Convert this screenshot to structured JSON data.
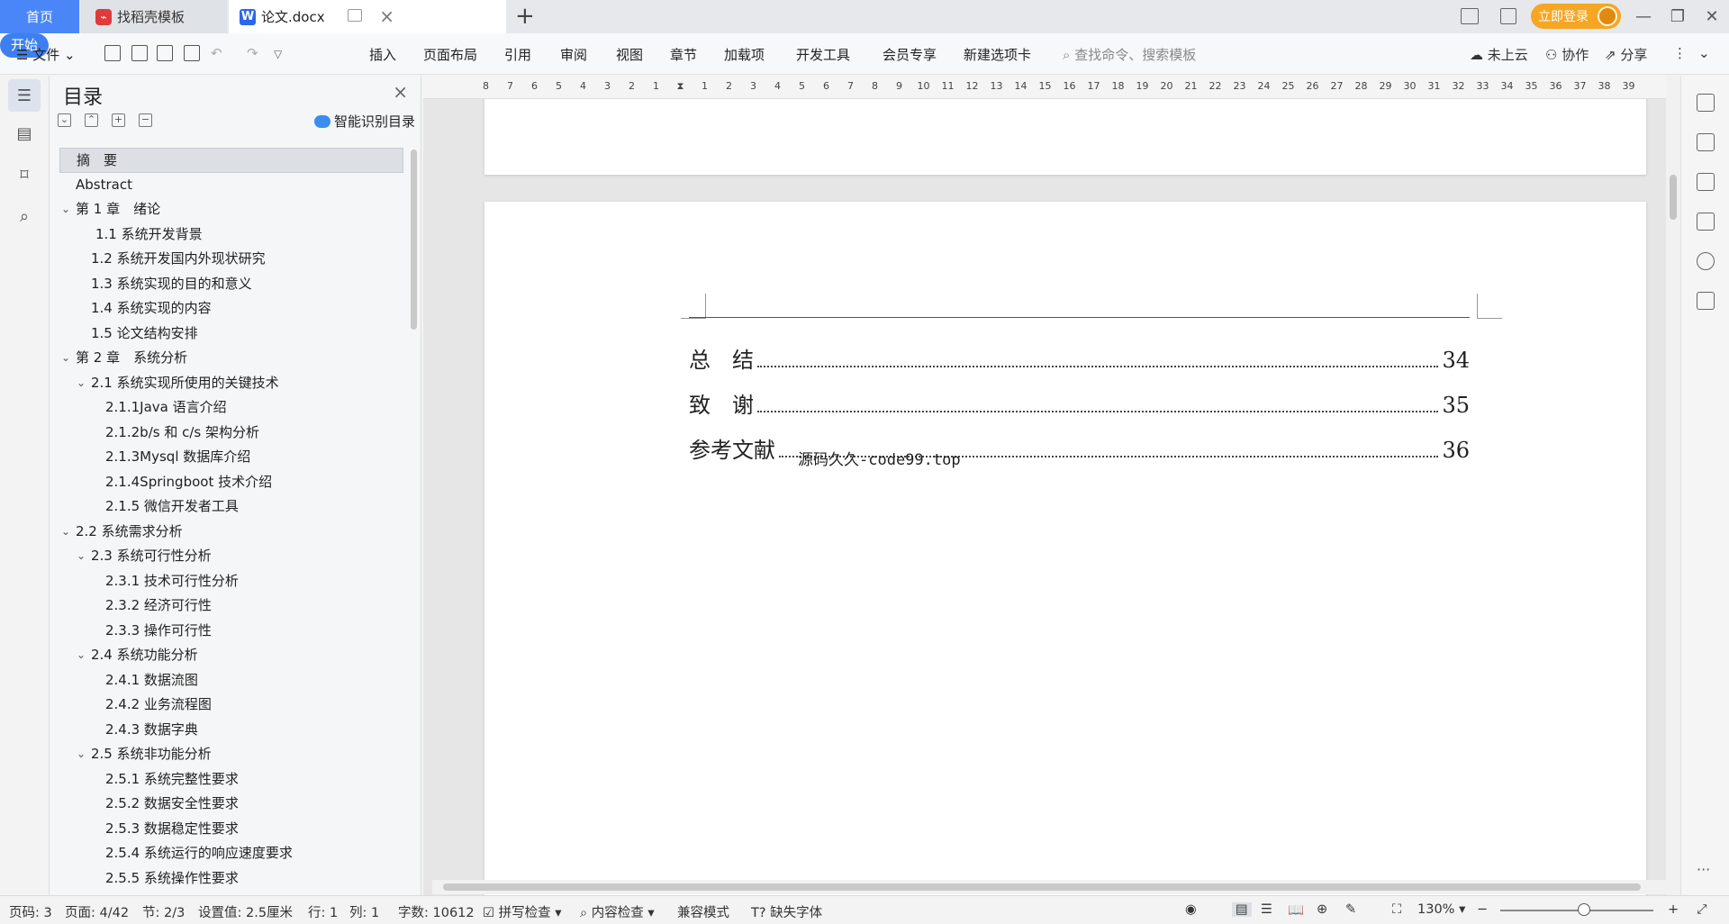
{
  "tabs": {
    "home": "首页",
    "template": "找稻壳模板",
    "document": "论文.docx"
  },
  "header_right": {
    "login": "立即登录"
  },
  "menu": {
    "file": "文件",
    "items": [
      "开始",
      "插入",
      "页面布局",
      "引用",
      "审阅",
      "视图",
      "章节",
      "加载项",
      "开发工具",
      "会员专享",
      "新建选项卡"
    ],
    "search_placeholder": "查找命令、搜索模板",
    "cloud": "未上云",
    "collab": "协作",
    "share": "分享"
  },
  "toc_panel": {
    "title": "目录",
    "smart_button": "智能识别目录",
    "items": [
      {
        "label": "摘　要",
        "level": 0,
        "selected": true
      },
      {
        "label": "Abstract",
        "level": 0
      },
      {
        "label": "第 1 章　绪论",
        "level": 0,
        "expandable": true
      },
      {
        "label": "1.1 系统开发背景",
        "level": 2
      },
      {
        "label": "1.2 系统开发国内外现状研究",
        "level": 1
      },
      {
        "label": "1.3 系统实现的目的和意义",
        "level": 1
      },
      {
        "label": "1.4 系统实现的内容",
        "level": 1
      },
      {
        "label": "1.5 论文结构安排",
        "level": 1
      },
      {
        "label": "第 2 章　系统分析",
        "level": 0,
        "expandable": true
      },
      {
        "label": "2.1 系统实现所使用的关键技术",
        "level": 1,
        "expandable": true
      },
      {
        "label": "2.1.1Java 语言介绍",
        "level": 2
      },
      {
        "label": "2.1.2b/s 和 c/s 架构分析",
        "level": 2
      },
      {
        "label": "2.1.3Mysql 数据库介绍",
        "level": 2
      },
      {
        "label": "2.1.4Springboot 技术介绍",
        "level": 2
      },
      {
        "label": "2.1.5 微信开发者工具",
        "level": 2
      },
      {
        "label": "2.2 系统需求分析",
        "level": 0,
        "expandable": true
      },
      {
        "label": "2.3 系统可行性分析",
        "level": 1,
        "expandable": true
      },
      {
        "label": "2.3.1 技术可行性分析",
        "level": 2
      },
      {
        "label": "2.3.2 经济可行性",
        "level": 2
      },
      {
        "label": "2.3.3 操作可行性",
        "level": 2
      },
      {
        "label": "2.4 系统功能分析",
        "level": 1,
        "expandable": true
      },
      {
        "label": "2.4.1 数据流图",
        "level": 2
      },
      {
        "label": "2.4.2  业务流程图",
        "level": 2
      },
      {
        "label": "2.4.3 数据字典",
        "level": 2
      },
      {
        "label": "2.5  系统非功能分析",
        "level": 1,
        "expandable": true
      },
      {
        "label": "2.5.1 系统完整性要求",
        "level": 2
      },
      {
        "label": "2.5.2 数据安全性要求",
        "level": 2
      },
      {
        "label": "2.5.3 数据稳定性要求",
        "level": 2
      },
      {
        "label": "2.5.4 系统运行的响应速度要求",
        "level": 2
      },
      {
        "label": "2.5.5 系统操作性要求",
        "level": 2
      }
    ]
  },
  "ruler_labels": [
    "8",
    "7",
    "6",
    "5",
    "4",
    "3",
    "2",
    "1",
    "",
    "1",
    "2",
    "3",
    "4",
    "5",
    "6",
    "7",
    "8",
    "9",
    "10",
    "11",
    "12",
    "13",
    "14",
    "15",
    "16",
    "17",
    "18",
    "19",
    "20",
    "21",
    "22",
    "23",
    "24",
    "25",
    "26",
    "27",
    "28",
    "29",
    "30",
    "31",
    "32",
    "33",
    "34",
    "35",
    "36",
    "37",
    "38",
    "39"
  ],
  "document": {
    "toc_entries": [
      {
        "label": "总　结",
        "page": "34"
      },
      {
        "label": "致　谢",
        "page": "35"
      },
      {
        "label": "参考文献",
        "page": "36"
      }
    ],
    "watermark": "源码久久-code99.top"
  },
  "status": {
    "page_num": "页码: 3",
    "page": "页面: 4/42",
    "section": "节: 2/3",
    "setting": "设置值: 2.5厘米",
    "row": "行: 1",
    "col": "列: 1",
    "words": "字数: 10612",
    "spell": "拼写检查",
    "content_check": "内容检查",
    "compat": "兼容模式",
    "missing_font": "缺失字体",
    "zoom": "130%"
  },
  "colors": {
    "accent": "#3d7ff1",
    "home_tab": "#4a86f7",
    "login": "#f5a623"
  }
}
